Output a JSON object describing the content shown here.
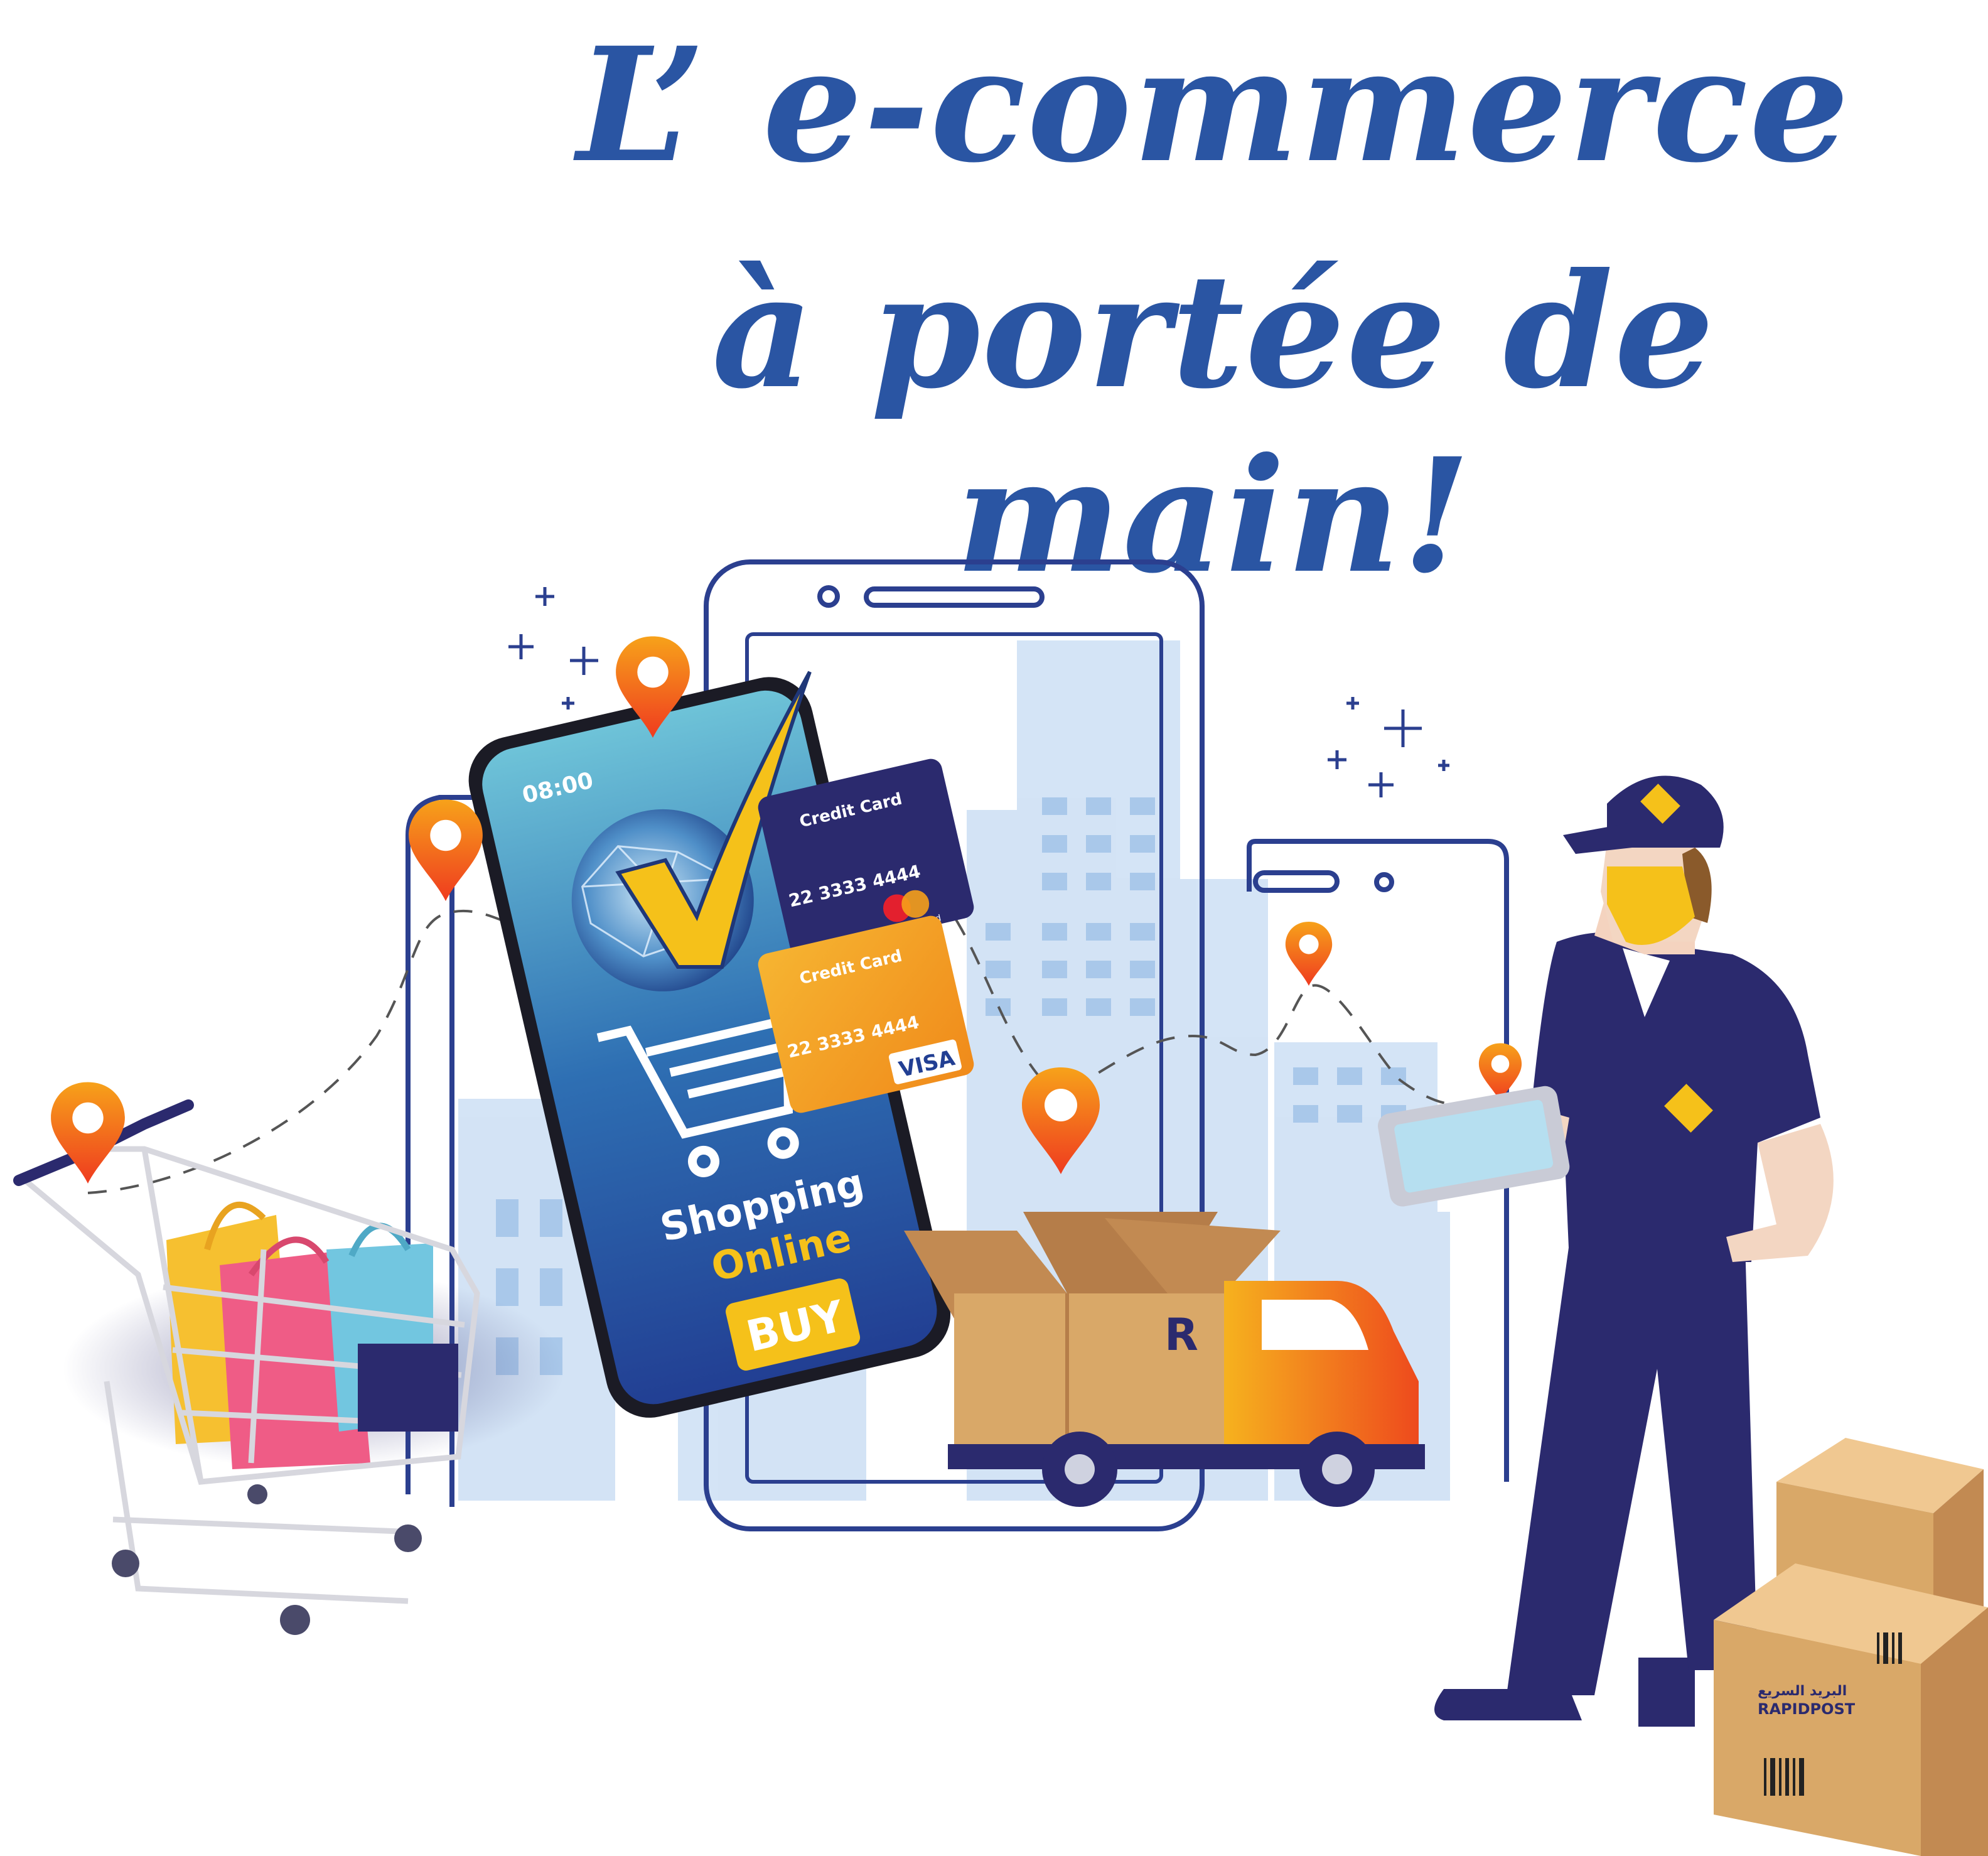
{
  "headline": {
    "line1": "L’ e-commerce",
    "line2": "à portée de main!"
  },
  "phone": {
    "time": "08:00",
    "shopping": "Shopping",
    "online": "Online",
    "buy": "BUY"
  },
  "cards": [
    {
      "label": "Credit Card",
      "number": "22 3333 4444",
      "brand": "mastercard"
    },
    {
      "label": "Credit Card",
      "number": "22 3333 4444",
      "brand": "VISA"
    }
  ],
  "boxes": {
    "brand_latin": "RAPIDPOST",
    "brand_arabic": "البريد السريع"
  },
  "colors": {
    "headline": "#2a55a3",
    "uniform": "#2b2a6e",
    "pin": "#f25a1d",
    "accent": "#f5c11a",
    "box": "#d9a868"
  }
}
